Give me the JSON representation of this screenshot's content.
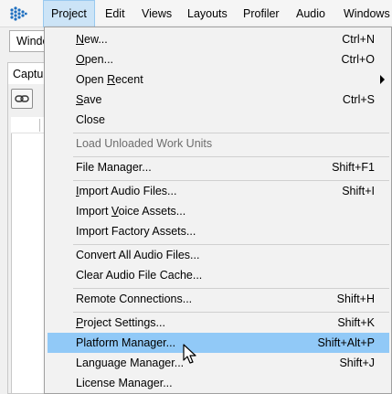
{
  "menubar": {
    "items": [
      "Project",
      "Edit",
      "Views",
      "Layouts",
      "Profiler",
      "Audio",
      "Windows"
    ]
  },
  "background": {
    "combo_text": "Windo",
    "tab_text": "Captur"
  },
  "project_menu": {
    "items": [
      {
        "pre": "",
        "ul": "N",
        "post": "ew...",
        "shortcut": "Ctrl+N"
      },
      {
        "pre": "",
        "ul": "O",
        "post": "pen...",
        "shortcut": "Ctrl+O"
      },
      {
        "pre": "Open ",
        "ul": "R",
        "post": "ecent",
        "shortcut": ""
      },
      {
        "pre": "",
        "ul": "S",
        "post": "ave",
        "shortcut": "Ctrl+S"
      },
      {
        "pre": "Close",
        "ul": "",
        "post": "",
        "shortcut": ""
      },
      {
        "pre": "Load Unloaded Work Units",
        "ul": "",
        "post": "",
        "shortcut": ""
      },
      {
        "pre": "File Manager...",
        "ul": "",
        "post": "",
        "shortcut": "Shift+F1"
      },
      {
        "pre": "",
        "ul": "I",
        "post": "mport Audio Files...",
        "shortcut": "Shift+I"
      },
      {
        "pre": "Import ",
        "ul": "V",
        "post": "oice Assets...",
        "shortcut": ""
      },
      {
        "pre": "Import Factory Assets...",
        "ul": "",
        "post": "",
        "shortcut": ""
      },
      {
        "pre": "Convert All Audio Files...",
        "ul": "",
        "post": "",
        "shortcut": ""
      },
      {
        "pre": "Clear Audio File Cache...",
        "ul": "",
        "post": "",
        "shortcut": ""
      },
      {
        "pre": "Remote Connections...",
        "ul": "",
        "post": "",
        "shortcut": "Shift+H"
      },
      {
        "pre": "",
        "ul": "P",
        "post": "roject Settings...",
        "shortcut": "Shift+K"
      },
      {
        "pre": "Platform Manager...",
        "ul": "",
        "post": "",
        "shortcut": "Shift+Alt+P"
      },
      {
        "pre": "Language Manager...",
        "ul": "",
        "post": "",
        "shortcut": "Shift+J"
      },
      {
        "pre": "License Manager...",
        "ul": "",
        "post": "",
        "shortcut": ""
      }
    ]
  },
  "icons": {
    "app_logo": "wwise-logo-icon",
    "submenu_arrow": "submenu-arrow-icon",
    "link": "link-icon",
    "cursor": "mouse-pointer-icon"
  },
  "colors": {
    "active_menu_bg": "#cce4f7",
    "highlight_bg": "#91c9f7",
    "menu_bg": "#f2f2f2",
    "logo": "#1e6fc0"
  }
}
